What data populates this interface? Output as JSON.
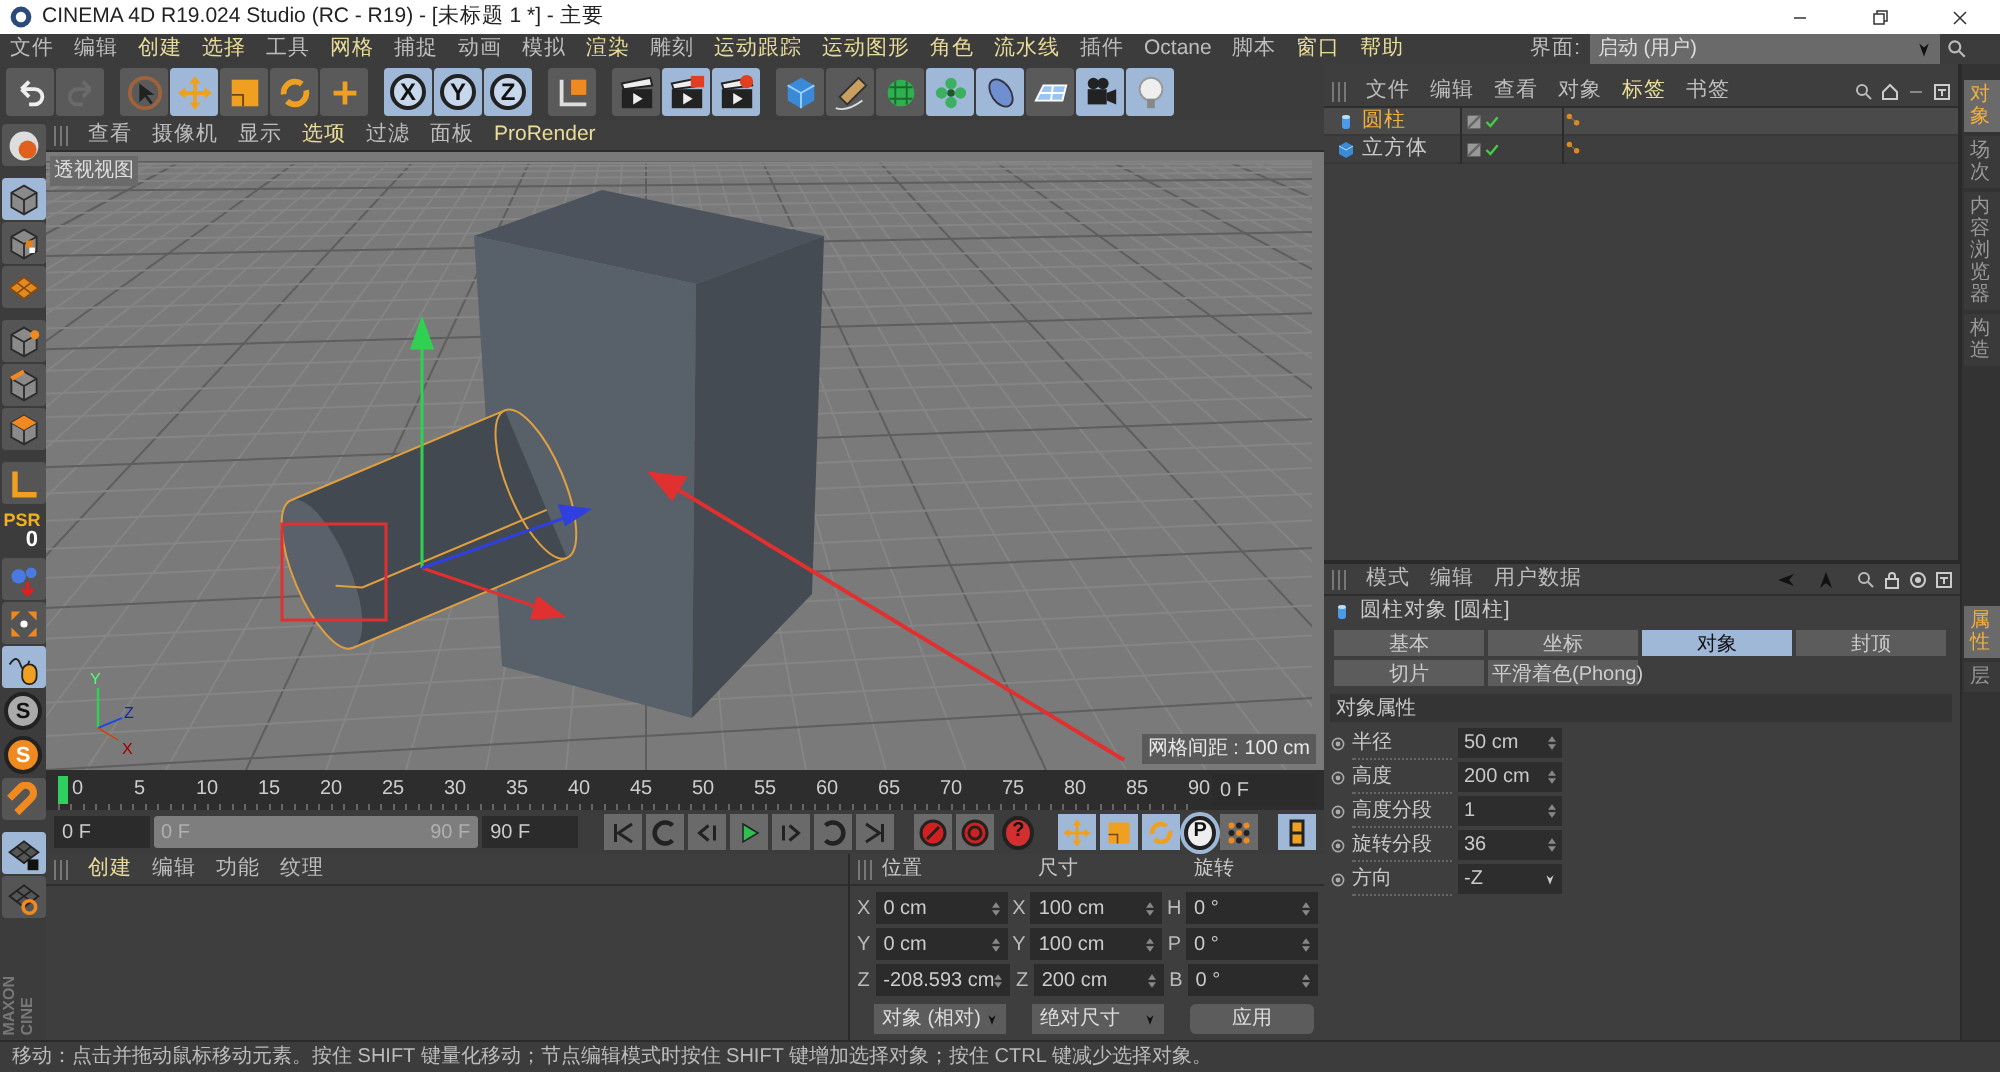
{
  "window": {
    "title": "CINEMA 4D R19.024 Studio (RC - R19) - [未标题 1 *] - 主要"
  },
  "menu": [
    {
      "label": "文件",
      "highlighted": false
    },
    {
      "label": "编辑",
      "highlighted": false
    },
    {
      "label": "创建",
      "highlighted": true
    },
    {
      "label": "选择",
      "highlighted": true
    },
    {
      "label": "工具",
      "highlighted": false
    },
    {
      "label": "网格",
      "highlighted": true
    },
    {
      "label": "捕捉",
      "highlighted": false
    },
    {
      "label": "动画",
      "highlighted": false
    },
    {
      "label": "模拟",
      "highlighted": false
    },
    {
      "label": "渲染",
      "highlighted": true
    },
    {
      "label": "雕刻",
      "highlighted": false
    },
    {
      "label": "运动跟踪",
      "highlighted": true
    },
    {
      "label": "运动图形",
      "highlighted": true
    },
    {
      "label": "角色",
      "highlighted": true
    },
    {
      "label": "流水线",
      "highlighted": true
    },
    {
      "label": "插件",
      "highlighted": false
    },
    {
      "label": "Octane",
      "highlighted": false
    },
    {
      "label": "脚本",
      "highlighted": false
    },
    {
      "label": "窗口",
      "highlighted": true
    },
    {
      "label": "帮助",
      "highlighted": true
    }
  ],
  "layout": {
    "label": "界面:",
    "value": "启动 (用户)"
  },
  "toolbar": [
    {
      "kind": "undo",
      "selected": false
    },
    {
      "kind": "redo",
      "selected": false
    },
    {
      "kind": "pointer",
      "selected": false
    },
    {
      "kind": "move",
      "selected": true
    },
    {
      "kind": "scale",
      "selected": false
    },
    {
      "kind": "rotate",
      "selected": false
    },
    {
      "kind": "add",
      "selected": false
    },
    {
      "kind": "axis",
      "label": "X",
      "selected": true
    },
    {
      "kind": "axis",
      "label": "Y",
      "selected": true
    },
    {
      "kind": "axis",
      "label": "Z",
      "selected": true
    },
    {
      "kind": "coord",
      "selected": false
    },
    {
      "kind": "clapper",
      "selected": false
    },
    {
      "kind": "clapper-red",
      "selected": true
    },
    {
      "kind": "clapper-gear",
      "selected": true
    },
    {
      "kind": "cube",
      "selected": false
    },
    {
      "kind": "pen",
      "selected": false
    },
    {
      "kind": "subdivide",
      "selected": false
    },
    {
      "kind": "cloner",
      "selected": true
    },
    {
      "kind": "deformer",
      "selected": true
    },
    {
      "kind": "floor",
      "selected": false
    },
    {
      "kind": "camera",
      "selected": true
    },
    {
      "kind": "light",
      "selected": true
    }
  ],
  "left_toolbar": [
    {
      "kind": "editable",
      "selected": false
    },
    {
      "kind": "model",
      "selected": true
    },
    {
      "kind": "texture",
      "selected": false
    },
    {
      "kind": "workplane",
      "selected": false
    },
    {
      "kind": "points",
      "selected": false
    },
    {
      "kind": "edges",
      "selected": false
    },
    {
      "kind": "polygons",
      "selected": false
    },
    {
      "kind": "axis-mode",
      "selected": false
    },
    {
      "kind": "psr",
      "label": "PSR",
      "value": "0",
      "selected": false
    },
    {
      "kind": "ik",
      "selected": false
    },
    {
      "kind": "soft",
      "selected": false
    },
    {
      "kind": "tweak",
      "selected": true
    },
    {
      "kind": "snap",
      "label": "S",
      "selected": false
    },
    {
      "kind": "snap-on",
      "label": "S",
      "selected": false
    },
    {
      "kind": "magnet",
      "selected": false
    },
    {
      "kind": "lockgrid",
      "selected": true
    },
    {
      "kind": "ringgrid",
      "selected": false
    }
  ],
  "viewport": {
    "menu": [
      {
        "label": "查看",
        "highlighted": false
      },
      {
        "label": "摄像机",
        "highlighted": false
      },
      {
        "label": "显示",
        "highlighted": false
      },
      {
        "label": "选项",
        "highlighted": true
      },
      {
        "label": "过滤",
        "highlighted": false
      },
      {
        "label": "面板",
        "highlighted": false
      },
      {
        "label": "ProRender",
        "highlighted": true
      }
    ],
    "view_name": "透视视图",
    "grid_spacing": "网格间距 : 100 cm",
    "axis_labels": [
      "Y",
      "Z",
      "X"
    ]
  },
  "timeline": {
    "ticks": [
      "0",
      "5",
      "10",
      "15",
      "20",
      "25",
      "30",
      "35",
      "40",
      "45",
      "50",
      "55",
      "60",
      "65",
      "70",
      "75",
      "80",
      "85",
      "90"
    ],
    "current_frame": "0 F"
  },
  "transport": {
    "start": "0 F",
    "range": {
      "start": "0 F",
      "end": "90 F",
      "level": 1
    },
    "end": "90 F",
    "buttons": [
      {
        "kind": "go-start",
        "selected": false
      },
      {
        "kind": "prev-key",
        "selected": false
      },
      {
        "kind": "prev-frame",
        "selected": false
      },
      {
        "kind": "play",
        "selected": false
      },
      {
        "kind": "next-frame",
        "selected": false
      },
      {
        "kind": "next-key",
        "selected": false
      },
      {
        "kind": "go-end",
        "selected": false
      },
      {
        "kind": "record",
        "selected": false
      },
      {
        "kind": "autokey",
        "selected": false
      },
      {
        "kind": "keyhelp",
        "label": "?",
        "selected": false
      },
      {
        "kind": "move",
        "selected": true
      },
      {
        "kind": "scale",
        "selected": true
      },
      {
        "kind": "rotate",
        "selected": true
      },
      {
        "kind": "param",
        "label": "P",
        "selected": true
      },
      {
        "kind": "dots",
        "selected": false
      },
      {
        "kind": "film",
        "selected": true
      }
    ]
  },
  "materials": {
    "menu": [
      {
        "label": "创建",
        "highlighted": true
      },
      {
        "label": "编辑",
        "highlighted": false
      },
      {
        "label": "功能",
        "highlighted": false
      },
      {
        "label": "纹理",
        "highlighted": false
      }
    ]
  },
  "coordinates": {
    "headers": [
      "位置",
      "尺寸",
      "旋转"
    ],
    "rows": [
      [
        {
          "axis": "X",
          "value": "0 cm"
        },
        {
          "axis": "X",
          "value": "100 cm"
        },
        {
          "axis": "H",
          "value": "0 °"
        }
      ],
      [
        {
          "axis": "Y",
          "value": "0 cm"
        },
        {
          "axis": "Y",
          "value": "100 cm"
        },
        {
          "axis": "P",
          "value": "0 °"
        }
      ],
      [
        {
          "axis": "Z",
          "value": "-208.593 cm"
        },
        {
          "axis": "Z",
          "value": "200 cm"
        },
        {
          "axis": "B",
          "value": "0 °"
        }
      ]
    ],
    "mode": "对象 (相对)",
    "size_mode": "绝对尺寸",
    "apply": "应用"
  },
  "object_manager": {
    "menu": [
      {
        "label": "文件",
        "highlighted": false
      },
      {
        "label": "编辑",
        "highlighted": false
      },
      {
        "label": "查看",
        "highlighted": false
      },
      {
        "label": "对象",
        "highlighted": false
      },
      {
        "label": "标签",
        "highlighted": true
      },
      {
        "label": "书签",
        "highlighted": false
      }
    ],
    "objects": [
      {
        "name": "圆柱",
        "kind": "cylinder",
        "selected": true
      },
      {
        "name": "立方体",
        "kind": "cube",
        "selected": false
      }
    ]
  },
  "attributes": {
    "menu": [
      {
        "label": "模式",
        "highlighted": false
      },
      {
        "label": "编辑",
        "highlighted": false
      },
      {
        "label": "用户数据",
        "highlighted": false
      }
    ],
    "title": "圆柱对象 [圆柱]",
    "tabs": [
      {
        "label": "基本",
        "selected": false
      },
      {
        "label": "坐标",
        "selected": false
      },
      {
        "label": "对象",
        "selected": true
      },
      {
        "label": "封顶",
        "selected": false
      },
      {
        "label": "切片",
        "selected": false
      },
      {
        "label": "平滑着色(Phong)",
        "selected": false
      }
    ],
    "section": "对象属性",
    "fields": [
      {
        "label": "半径",
        "value": "50 cm",
        "kind": "number"
      },
      {
        "label": "高度",
        "value": "200 cm",
        "kind": "number"
      },
      {
        "label": "高度分段",
        "value": "1",
        "kind": "number"
      },
      {
        "label": "旋转分段",
        "value": "36",
        "kind": "number"
      },
      {
        "label": "方向",
        "value": "-Z",
        "kind": "dropdown"
      }
    ]
  },
  "side_tabs": [
    {
      "label": "对象",
      "selected": true
    },
    {
      "label": "场次",
      "selected": false
    },
    {
      "label": "内容浏览器",
      "selected": false
    },
    {
      "label": "构造",
      "selected": false
    }
  ],
  "attribute_side_tabs": [
    {
      "label": "属性",
      "selected": true
    },
    {
      "label": "层",
      "selected": false
    }
  ],
  "logo": [
    "MAXON",
    "CINE"
  ],
  "status_bar": "移动：点击并拖动鼠标移动元素。按住 SHIFT 键量化移动；节点编辑模式时按住 SHIFT 键增加选择对象；按住 CTRL 键减少选择对象。"
}
